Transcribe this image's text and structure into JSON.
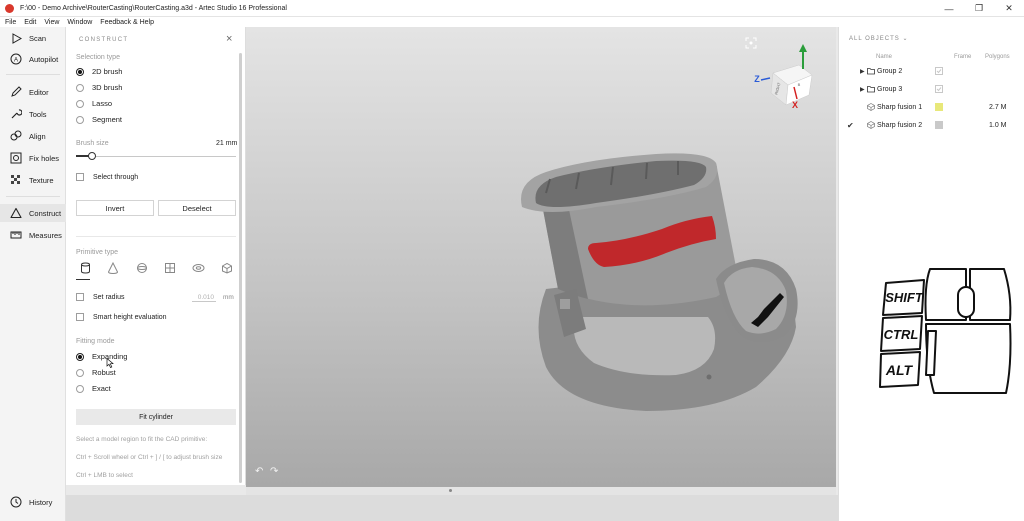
{
  "window": {
    "title": "F:\\00 - Demo Archive\\RouterCasting\\RouterCasting.a3d - Artec Studio 16 Professional",
    "controls": [
      "—",
      "❐",
      "✕"
    ]
  },
  "menu": [
    "File",
    "Edit",
    "View",
    "Window",
    "Feedback & Help"
  ],
  "tools": {
    "scan": "Scan",
    "autopilot": "Autopilot",
    "editor": "Editor",
    "tools": "Tools",
    "align": "Align",
    "fix_holes": "Fix holes",
    "texture": "Texture",
    "construct": "Construct",
    "measures": "Measures",
    "history": "History"
  },
  "construct": {
    "title": "CONSTRUCT",
    "close": "×",
    "selection_type_label": "Selection type",
    "selection_types": [
      "2D brush",
      "3D brush",
      "Lasso",
      "Segment"
    ],
    "selected_selection_type": "2D brush",
    "brush_size_label": "Brush size",
    "brush_size_value": "21 mm",
    "select_through_label": "Select through",
    "invert_label": "Invert",
    "deselect_label": "Deselect",
    "primitive_type_label": "Primitive type",
    "primitive_icons": [
      "cylinder-icon",
      "cone-icon",
      "sphere-icon",
      "plane-icon",
      "torus-icon",
      "box-icon"
    ],
    "selected_primitive": "cylinder-icon",
    "set_radius_label": "Set radius",
    "set_radius_value": "0.010",
    "set_radius_unit": "mm",
    "smart_height_label": "Smart height evaluation",
    "fitting_mode_label": "Fitting mode",
    "fitting_modes": [
      "Expanding",
      "Robust",
      "Exact"
    ],
    "selected_fitting_mode": "Expanding",
    "fit_button_label": "Fit cylinder",
    "hints": [
      "Select a model region to fit the CAD primitive:",
      "Ctrl + Scroll wheel or Ctrl + ] / [ to adjust brush size",
      "Ctrl + LMB to select"
    ]
  },
  "viewport": {
    "undo": "↶",
    "redo": "↷",
    "gizmo_axes": [
      "Z",
      "X"
    ],
    "gizmo_face_labels": [
      "RIGHT",
      "B"
    ],
    "model_color": "#8e8e8e",
    "selection_color": "#c0282b"
  },
  "objects": {
    "header": "ALL OBJECTS",
    "columns": {
      "name": "Name",
      "frame": "Frame",
      "polygons": "Polygons"
    },
    "rows": [
      {
        "name": "Group 2",
        "type": "folder",
        "frame_color": "",
        "polygons": "",
        "visible": false,
        "expandable": true
      },
      {
        "name": "Group 3",
        "type": "folder",
        "frame_color": "",
        "polygons": "",
        "visible": false,
        "expandable": true
      },
      {
        "name": "Sharp fusion 1",
        "type": "model",
        "frame_color": "#e8e87a",
        "polygons": "2.7 M",
        "visible": false,
        "expandable": false
      },
      {
        "name": "Sharp fusion 2",
        "type": "model",
        "frame_color": "#c9c9c9",
        "polygons": "1.0 M",
        "visible": true,
        "expandable": false
      }
    ]
  },
  "keyboard_overlay": {
    "keys": [
      "SHIFT",
      "CTRL",
      "ALT"
    ]
  }
}
